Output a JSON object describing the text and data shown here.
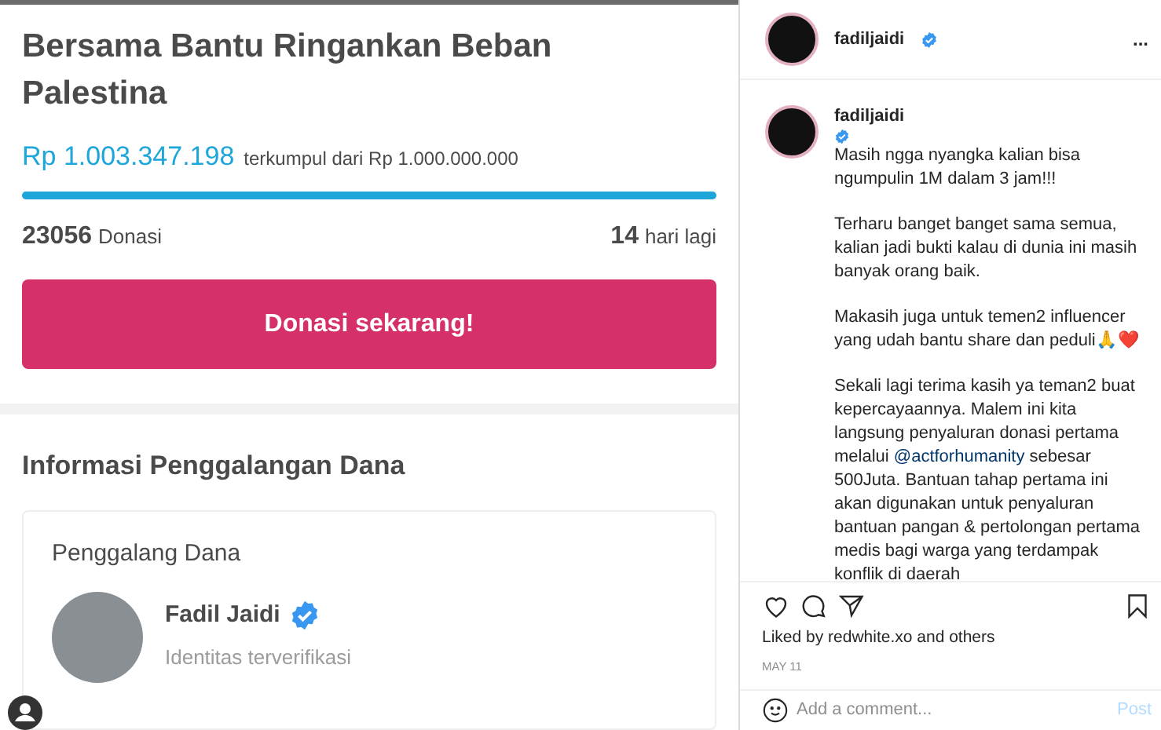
{
  "campaign": {
    "title": "Bersama Bantu Ringankan Beban Palestina",
    "amount": "Rp 1.003.347.198",
    "amount_note": "terkumpul dari Rp 1.000.000.000",
    "level": 1,
    "donations_count": "23056",
    "donations_label": "Donasi",
    "days_count": "14",
    "days_label": "hari lagi",
    "donate_button": "Donasi sekarang!"
  },
  "fundraiser_info": {
    "heading": "Informasi Penggalangan Dana",
    "card_title": "Penggalang Dana",
    "name": "Fadil Jaidi",
    "verified": true,
    "status": "Identitas terverifikasi"
  },
  "post": {
    "username": "fadiljaidi",
    "verified": true,
    "more": "...",
    "caption": [
      [
        {
          "kind": "username",
          "text": "fadiljaidi"
        },
        {
          "kind": "text",
          "text": "Masih ngga nyangka kalian bisa ngumpulin 1M dalam 3 jam!!!"
        }
      ],
      [
        {
          "kind": "text",
          "text": "Terharu banget banget sama semua, kalian jadi bukti kalau di dunia ini masih banyak orang baik."
        }
      ],
      [
        {
          "kind": "text",
          "text": "Makasih juga untuk temen2 influencer yang udah bantu share dan peduli🙏❤️"
        }
      ],
      [
        {
          "kind": "text",
          "text": "Sekali lagi terima kasih ya teman2 buat kepercayaannya. Malem ini kita langsung penyaluran donasi pertama melalui "
        },
        {
          "kind": "mention",
          "text": "@actforhumanity"
        },
        {
          "kind": "text",
          "text": " sebesar 500Juta. Bantuan tahap pertama ini akan digunakan untuk penyaluran bantuan pangan & pertolongan pertama medis bagi warga yang terdampak konflik di daerah"
        }
      ]
    ],
    "likes": "Liked by redwhite.xo and others",
    "date": "MAY 11",
    "comment_placeholder": "Add a comment...",
    "post_button": "Post"
  }
}
